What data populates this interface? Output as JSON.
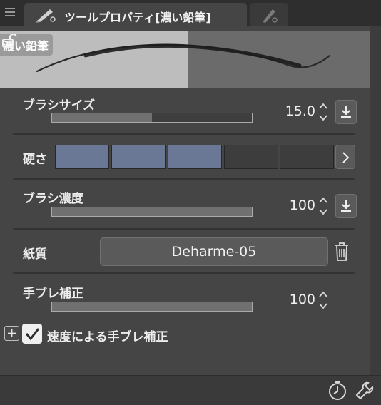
{
  "tab": {
    "title": "ツールプロパティ[濃い鉛筆]"
  },
  "preview": {
    "brush_name": "濃い鉛筆"
  },
  "properties": {
    "brush_size": {
      "label": "ブラシサイズ",
      "value": "15.0",
      "fill_percent": 50
    },
    "hardness": {
      "label": "硬さ",
      "levels": 5,
      "selected": 3
    },
    "brush_density": {
      "label": "ブラシ濃度",
      "value": "100",
      "fill_percent": 100
    },
    "paper": {
      "label": "紙質",
      "value": "Deharme-05"
    },
    "stabilization": {
      "label": "手ブレ補正",
      "value": "100",
      "fill_percent": 100
    },
    "speed_stabilization": {
      "label": "速度による手ブレ補正",
      "checked": true
    }
  },
  "colors": {
    "accent": "#6b7895",
    "panel": "#454545",
    "background": "#3a3a3a"
  },
  "icons": {
    "menu": "hamburger-icon",
    "tab_active": "pencil-tool-icon",
    "tab_inactive": "brush-tool-icon",
    "lock": "lock-icon",
    "download": "download-icon",
    "next": "chevron-right-icon",
    "trash": "trash-icon",
    "expand": "plus-icon",
    "check": "checkmark-icon",
    "clock": "clock-icon",
    "wrench": "wrench-icon"
  }
}
